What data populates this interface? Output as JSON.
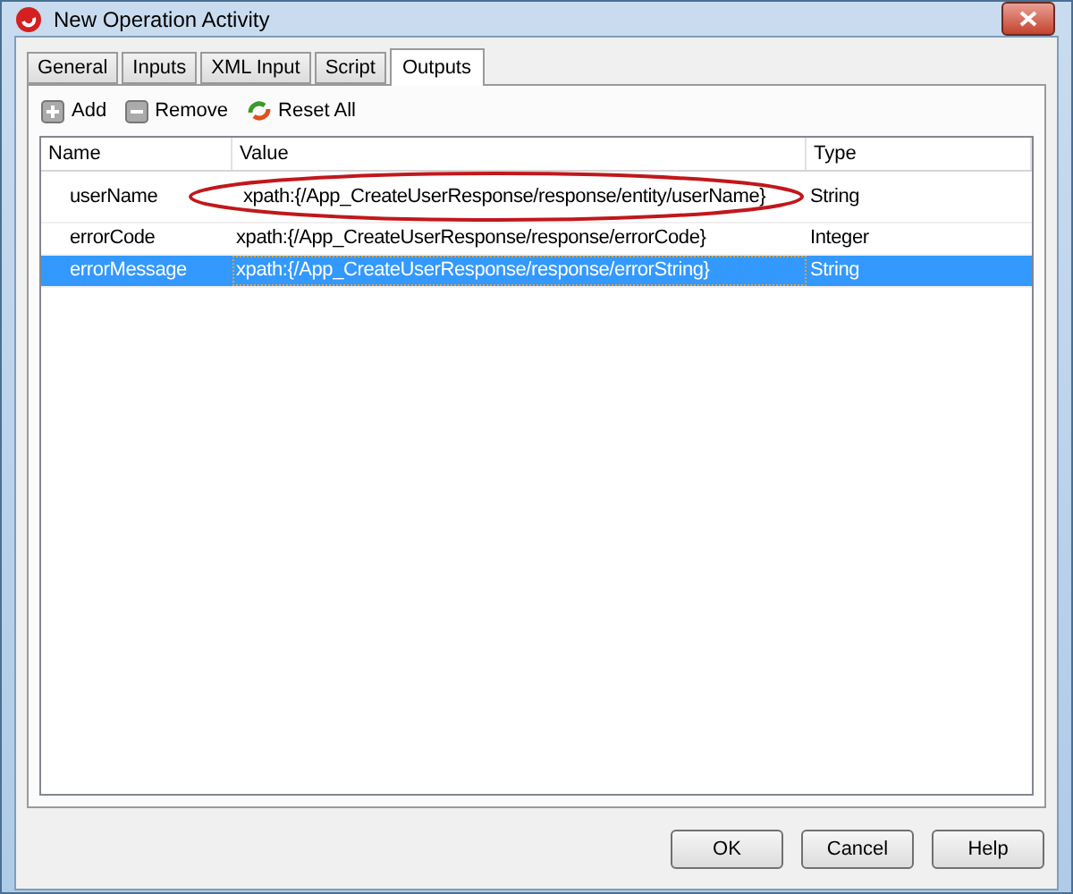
{
  "window": {
    "title": "New Operation Activity"
  },
  "tabs": [
    {
      "label": "General",
      "selected": false
    },
    {
      "label": "Inputs",
      "selected": false
    },
    {
      "label": "XML Input",
      "selected": false
    },
    {
      "label": "Script",
      "selected": false
    },
    {
      "label": "Outputs",
      "selected": true
    }
  ],
  "toolbar": [
    {
      "kind": "add",
      "label": "Add"
    },
    {
      "kind": "remove",
      "label": "Remove"
    },
    {
      "kind": "reset",
      "label": "Reset All"
    }
  ],
  "table": {
    "columns": [
      "Name",
      "Value",
      "Type"
    ],
    "rows": [
      {
        "name": "userName",
        "value": "xpath:{/App_CreateUserResponse/response/entity/userName}",
        "type": "String",
        "selected": false,
        "circled": true
      },
      {
        "name": "errorCode",
        "value": "xpath:{/App_CreateUserResponse/response/errorCode}",
        "type": "Integer",
        "selected": false,
        "circled": false
      },
      {
        "name": "errorMessage",
        "value": "xpath:{/App_CreateUserResponse/response/errorString}",
        "type": "String",
        "selected": true,
        "circled": false
      }
    ]
  },
  "buttons": [
    "OK",
    "Cancel",
    "Help"
  ]
}
